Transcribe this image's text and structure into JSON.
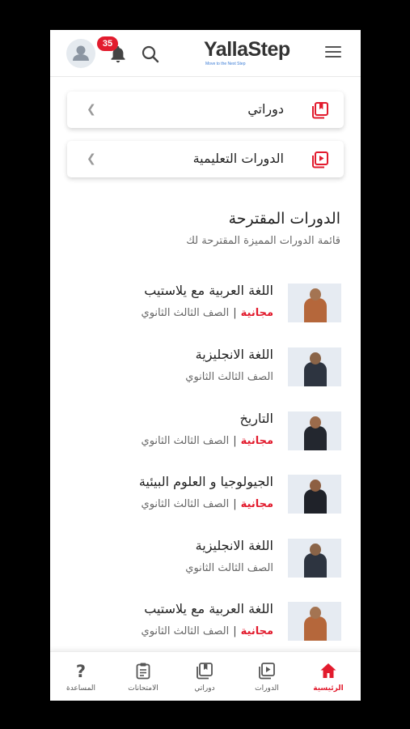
{
  "header": {
    "logo_text": "YallaStep",
    "logo_tagline": "Move to the Next Step",
    "notification_count": "35"
  },
  "menu_cards": [
    {
      "label": "دوراتي",
      "icon": "book-icon"
    },
    {
      "label": "الدورات التعليمية",
      "icon": "video-playlist-icon"
    }
  ],
  "section": {
    "title": "الدورات المقترحة",
    "subtitle": "قائمة الدورات المميزة المقترحة لك"
  },
  "courses": [
    {
      "title": "اللغة العربية مع يلاستيب",
      "free": "مجانية",
      "grade": "الصف الثالث الثانوي"
    },
    {
      "title": "اللغة الانجليزية",
      "free": "",
      "grade": "الصف الثالث الثانوي"
    },
    {
      "title": "التاريخ",
      "free": "مجانية",
      "grade": "الصف الثالث الثانوي"
    },
    {
      "title": "الجيولوجيا و العلوم البيئية",
      "free": "مجانية",
      "grade": "الصف الثالث الثانوي"
    },
    {
      "title": "اللغة الانجليزية",
      "free": "",
      "grade": "الصف الثالث الثانوي"
    },
    {
      "title": "اللغة العربية مع يلاستيب",
      "free": "مجانية",
      "grade": "الصف الثالث الثانوي"
    }
  ],
  "bottom_nav": [
    {
      "label": "الرئيسية",
      "icon": "home-icon",
      "active": true
    },
    {
      "label": "الدورات",
      "icon": "video-playlist-icon",
      "active": false
    },
    {
      "label": "دوراتي",
      "icon": "book-icon",
      "active": false
    },
    {
      "label": "الامتحانات",
      "icon": "clipboard-icon",
      "active": false
    },
    {
      "label": "المساعدة",
      "icon": "help-icon",
      "active": false
    }
  ],
  "colors": {
    "accent": "#e21b2d",
    "text": "#222222",
    "muted": "#666666"
  }
}
